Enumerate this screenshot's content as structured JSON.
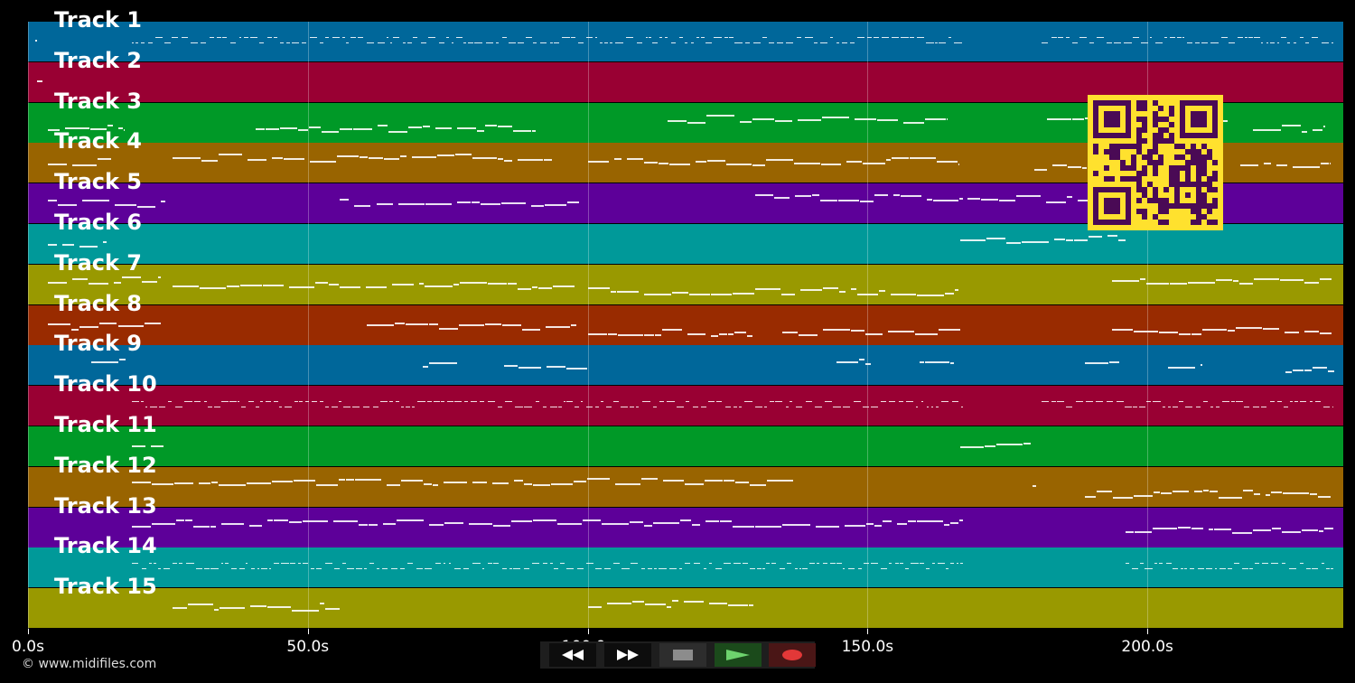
{
  "tracks": [
    {
      "label": "Track 1",
      "color": "#00679a",
      "notes": [
        [
          8,
          2
        ],
        [
          115,
          920
        ],
        [
          1122,
          323
        ]
      ],
      "dense": true
    },
    {
      "label": "Track 2",
      "color": "#990033",
      "notes": [
        [
          10,
          6
        ]
      ]
    },
    {
      "label": "Track 3",
      "color": "#009927",
      "notes": [
        [
          22,
          85
        ],
        [
          252,
          310
        ],
        [
          708,
          310
        ],
        [
          1128,
          200
        ],
        [
          1356,
          80
        ]
      ]
    },
    {
      "label": "Track 4",
      "color": "#996400",
      "notes": [
        [
          22,
          70
        ],
        [
          160,
          420
        ],
        [
          620,
          410
        ],
        [
          1114,
          90
        ],
        [
          1342,
          100
        ]
      ]
    },
    {
      "label": "Track 5",
      "color": "#5d0099",
      "notes": [
        [
          22,
          130
        ],
        [
          345,
          265
        ],
        [
          805,
          230
        ],
        [
          1040,
          170
        ]
      ]
    },
    {
      "label": "Track 6",
      "color": "#009999",
      "notes": [
        [
          22,
          65
        ],
        [
          1032,
          183
        ]
      ]
    },
    {
      "label": "Track 7",
      "color": "#999900",
      "notes": [
        [
          22,
          125
        ],
        [
          160,
          445
        ],
        [
          620,
          410
        ],
        [
          1200,
          243
        ]
      ]
    },
    {
      "label": "Track 8",
      "color": "#992b00",
      "notes": [
        [
          22,
          125
        ],
        [
          375,
          232
        ],
        [
          620,
          182
        ],
        [
          835,
          197
        ],
        [
          1200,
          243
        ]
      ]
    },
    {
      "label": "Track 9",
      "color": "#00679a",
      "notes": [
        [
          70,
          38
        ],
        [
          437,
          38
        ],
        [
          527,
          92
        ],
        [
          895,
          38
        ],
        [
          987,
          38
        ],
        [
          1170,
          38
        ],
        [
          1262,
          38
        ],
        [
          1392,
          54
        ]
      ]
    },
    {
      "label": "Track 10",
      "color": "#990033",
      "notes": [
        [
          115,
          920
        ],
        [
          1122,
          323
        ]
      ],
      "dense": true
    },
    {
      "label": "Track 11",
      "color": "#009927",
      "notes": [
        [
          115,
          35
        ],
        [
          1032,
          78
        ]
      ]
    },
    {
      "label": "Track 12",
      "color": "#996400",
      "notes": [
        [
          115,
          735
        ],
        [
          1112,
          4
        ],
        [
          1170,
          273
        ]
      ]
    },
    {
      "label": "Track 13",
      "color": "#5d0099",
      "notes": [
        [
          115,
          920
        ],
        [
          1215,
          230
        ]
      ]
    },
    {
      "label": "Track 14",
      "color": "#009999",
      "notes": [
        [
          115,
          920
        ],
        [
          1215,
          230
        ]
      ],
      "dense": true
    },
    {
      "label": "Track 15",
      "color": "#999900",
      "notes": [
        [
          160,
          185
        ],
        [
          620,
          183
        ]
      ]
    }
  ],
  "axis": {
    "x_range_seconds": [
      0,
      235
    ],
    "ticks": [
      {
        "value": 0,
        "label": "0.0s"
      },
      {
        "value": 50,
        "label": "50.0s"
      },
      {
        "value": 100,
        "label": "100.0s"
      },
      {
        "value": 150,
        "label": "150.0s"
      },
      {
        "value": 200,
        "label": "200.0s"
      }
    ]
  },
  "copyright": "© www.midifiles.com",
  "transport": [
    {
      "name": "rewind-button",
      "icon": "rewind-icon",
      "bg": "#0d0d0d",
      "fg": "#ffffff"
    },
    {
      "name": "fast-forward-button",
      "icon": "fast-forward-icon",
      "bg": "#0d0d0d",
      "fg": "#ffffff"
    },
    {
      "name": "stop-button",
      "icon": "stop-icon",
      "bg": "#2d2d2d",
      "fg": "#8c8c8c"
    },
    {
      "name": "play-button",
      "icon": "play-icon",
      "bg": "#1b4a1b",
      "fg": "#6dd36d"
    },
    {
      "name": "record-button",
      "icon": "record-icon",
      "bg": "#4a1616",
      "fg": "#e23838"
    }
  ],
  "qr_colors": {
    "fg": "#4a0a55",
    "bg": "#ffe12e"
  }
}
